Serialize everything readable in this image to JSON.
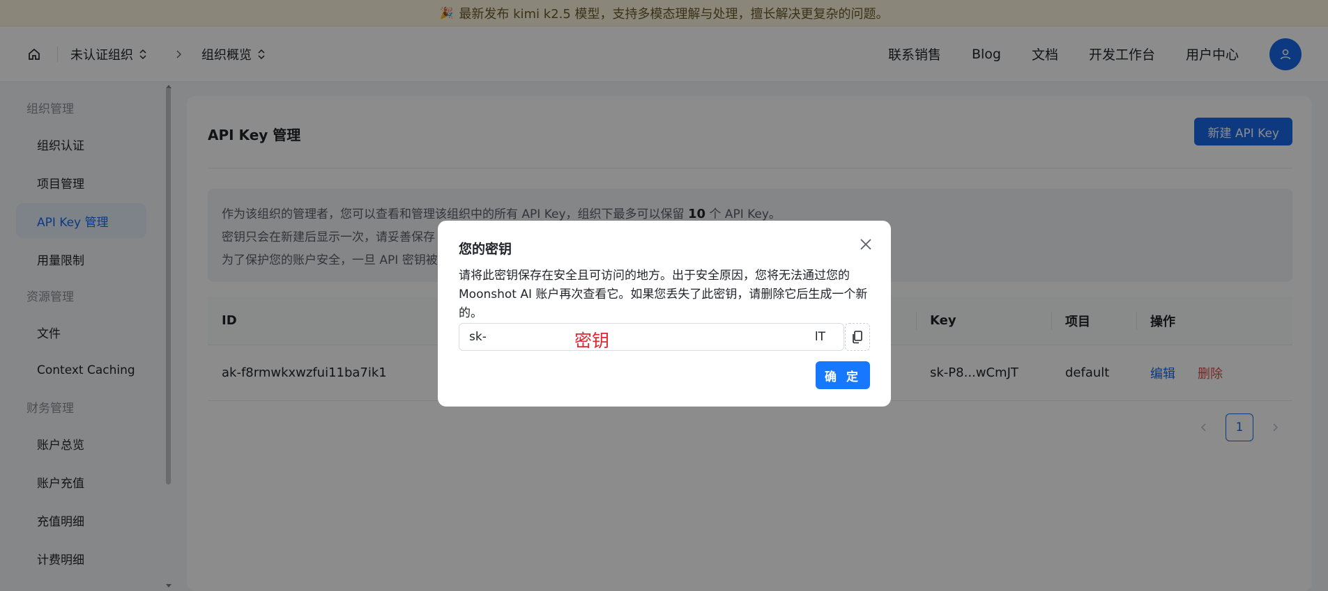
{
  "banner": {
    "text": "最新发布 kimi k2.5 模型，支持多模态理解与处理，擅长解决更复杂的问题。"
  },
  "breadcrumb": {
    "org": "未认证组织",
    "page": "组织概览"
  },
  "topnav": {
    "sales": "联系销售",
    "blog": "Blog",
    "docs": "文档",
    "workbench": "开发工作台",
    "user_center": "用户中心"
  },
  "sidebar": {
    "org_group": "组织管理",
    "org_items": [
      "组织认证",
      "项目管理",
      "API Key 管理",
      "用量限制"
    ],
    "res_group": "资源管理",
    "res_items": [
      "文件",
      "Context Caching"
    ],
    "fin_group": "财务管理",
    "fin_items": [
      "账户总览",
      "账户充值",
      "充值明细",
      "计费明细"
    ]
  },
  "main": {
    "title": "API Key 管理",
    "new_button": "新建 API Key",
    "notice": {
      "line1_pre": "作为该组织的管理者，您可以查看和管理该组织中的所有 API Key，组织下最多可以保留",
      "line1_num": "10",
      "line1_post": "个 API Key。",
      "line2": "密钥只会在新建后显示一次，请妥善保存",
      "line3": "为了保护您的账户安全，一旦 API 密钥被"
    },
    "table": {
      "headers": {
        "id": "ID",
        "key": "Key",
        "project": "项目",
        "actions": "操作"
      },
      "rows": [
        {
          "id": "ak-f8rmwkxwzfui11ba7ik1",
          "key": "sk-P8...wCmJT",
          "project": "default",
          "edit": "编辑",
          "delete": "删除"
        }
      ]
    },
    "pagination": {
      "current": "1"
    }
  },
  "modal": {
    "title": "您的密钥",
    "description": "请将此密钥保存在安全且可访问的地方。出于安全原因，您将无法通过您的 Moonshot AI 账户再次查看它。如果您丢失了此密钥，请删除它后生成一个新的。",
    "key_prefix": "sk-",
    "key_redaction_label": "密钥",
    "key_suffix": "lT",
    "ok_button": "确 定"
  },
  "colors": {
    "primary": "#1769e8",
    "danger": "#e04848",
    "redaction": "#e0262f",
    "banner_bg": "#fcf5dc"
  },
  "icons": [
    "home-icon",
    "updown-icon",
    "chevron-right-icon",
    "user-icon",
    "close-icon",
    "copy-icon",
    "chevron-left-icon",
    "party-icon"
  ]
}
